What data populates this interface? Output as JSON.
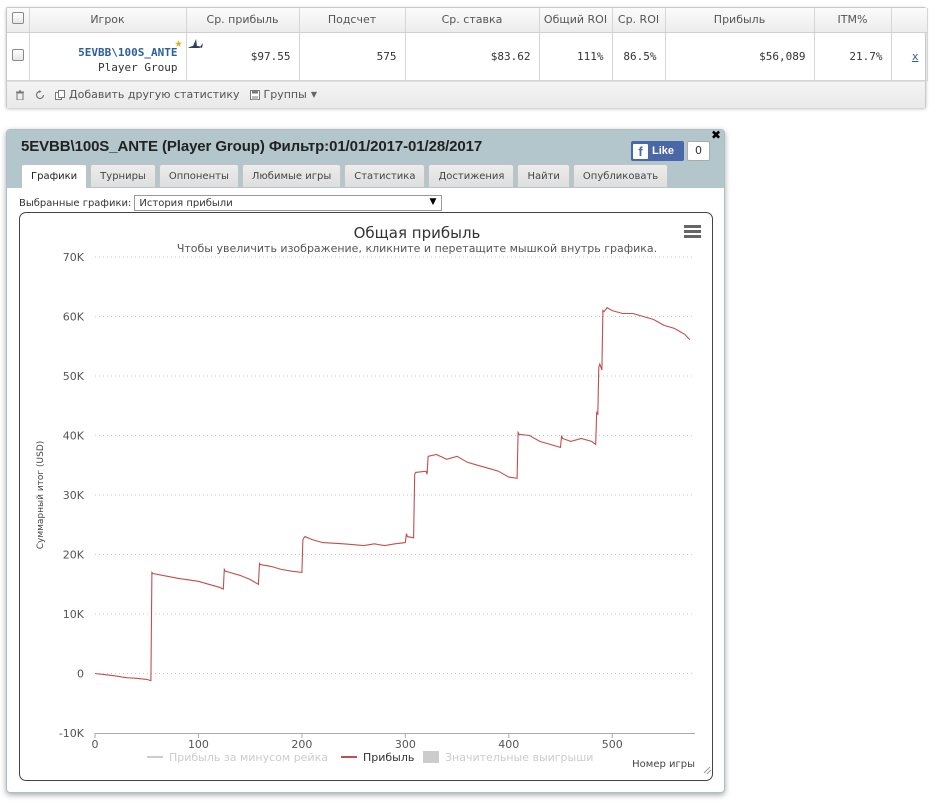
{
  "stats_table": {
    "headers": [
      "Игрок",
      "Ср. прибыль",
      "Подсчет",
      "Ср. ставка",
      "Общий ROI",
      "Ср. ROI",
      "Прибыль",
      "ITM%"
    ],
    "row": {
      "player_name": "5EVBB\\100S_ANTE",
      "player_group": "Player Group",
      "avg_profit": "$97.55",
      "count": "575",
      "avg_stake": "$83.62",
      "total_roi": "111%",
      "avg_roi": "86.5%",
      "profit": "$56,089",
      "itm": "21.7%",
      "remove_link": "x"
    },
    "toolbar": {
      "add_stat_label": "Добавить другую статистику",
      "groups_label": "Группы"
    }
  },
  "panel": {
    "title": "5EVBB\\100S_ANTE (Player Group) Фильтр:01/01/2017-01/28/2017",
    "fb_like_label": "Like",
    "fb_like_count": "0",
    "tabs": [
      "Графики",
      "Турниры",
      "Оппоненты",
      "Любимые игры",
      "Статистика",
      "Достижения",
      "Найти",
      "Опубликовать"
    ],
    "active_tab": "Графики",
    "chart_selector_label": "Выбранные графики:",
    "chart_selector_value": "История прибыли"
  },
  "colors": {
    "header_bg": "#b3c6cc",
    "link": "#2b5f9a",
    "profit_line": "#c0504d",
    "fb_blue": "#4a67a8"
  },
  "chart_data": {
    "type": "line",
    "title": "Общая прибыль",
    "subtitle": "Чтобы увеличить изображение, кликните и перетащите мышкой внутрь графика.",
    "xlabel": "Номер игры",
    "ylabel": "Суммарный итог (USD)",
    "xlim": [
      0,
      580
    ],
    "ylim": [
      -10000,
      70000
    ],
    "x_ticks": [
      "0",
      "100",
      "200",
      "300",
      "400",
      "500"
    ],
    "y_ticks": [
      "-10K",
      "0",
      "10K",
      "20K",
      "30K",
      "40K",
      "50K",
      "60K",
      "70K"
    ],
    "grid": true,
    "legend_position": "bottom",
    "legend": [
      "Прибыль за минусом рейка",
      "Прибыль",
      "Значительные выигрыши"
    ],
    "series": [
      {
        "name": "Прибыль",
        "x": [
          0,
          10,
          20,
          30,
          40,
          50,
          54,
          55,
          56,
          65,
          80,
          100,
          110,
          120,
          124,
          125,
          126,
          130,
          140,
          150,
          158,
          159,
          160,
          170,
          180,
          190,
          200,
          201,
          202,
          203,
          210,
          220,
          240,
          260,
          270,
          280,
          290,
          300,
          301,
          302,
          308,
          309,
          310,
          320,
          321,
          322,
          330,
          340,
          350,
          360,
          370,
          380,
          390,
          400,
          408,
          409,
          410,
          420,
          430,
          440,
          450,
          451,
          452,
          460,
          470,
          480,
          484,
          485,
          486,
          487,
          488,
          490,
          491,
          492,
          495,
          500,
          510,
          520,
          530,
          540,
          550,
          560,
          570,
          575
        ],
        "values": [
          0,
          -200,
          -400,
          -700,
          -800,
          -1000,
          -1200,
          17000,
          16800,
          16500,
          16000,
          15500,
          15000,
          14500,
          14200,
          17500,
          17200,
          17000,
          16500,
          15800,
          15000,
          18500,
          18300,
          18000,
          17500,
          17200,
          17000,
          22500,
          22800,
          23000,
          22500,
          22000,
          21800,
          21500,
          21800,
          21500,
          21800,
          22000,
          23500,
          23000,
          22800,
          33500,
          33800,
          34000,
          33500,
          36500,
          36800,
          36000,
          36500,
          35500,
          35000,
          34500,
          34000,
          33000,
          32800,
          40500,
          40200,
          40000,
          39000,
          38500,
          38000,
          40000,
          39500,
          39000,
          39500,
          39000,
          38500,
          44000,
          43500,
          51500,
          52000,
          51000,
          61000,
          60800,
          61500,
          61000,
          60500,
          60500,
          60000,
          59500,
          58500,
          58000,
          57000,
          56089
        ]
      }
    ]
  }
}
